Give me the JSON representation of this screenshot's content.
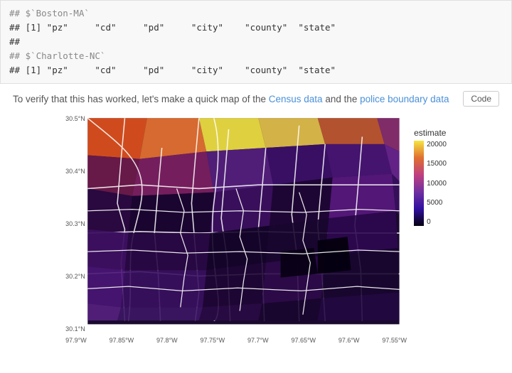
{
  "code_block": {
    "lines": [
      {
        "text": "## $`Boston-MA`",
        "type": "comment"
      },
      {
        "text": "## [1] \"pz\"     \"cd\"     \"pd\"     \"city\"    \"county\"  \"state\"",
        "type": "normal"
      },
      {
        "text": "## ",
        "type": "normal"
      },
      {
        "text": "## $`Charlotte-NC`",
        "type": "comment"
      },
      {
        "text": "## [1] \"pz\"     \"cd\"     \"pd\"     \"city\"    \"county\"  \"state\"",
        "type": "normal"
      }
    ]
  },
  "description": {
    "text": "To verify that this has worked, let's make a quick map of the Census data and the police boundary data",
    "link_words": [
      "Census data",
      "police boundary data"
    ],
    "code_button_label": "Code"
  },
  "map": {
    "y_labels": [
      "30.5°N",
      "30.4°N",
      "30.3°N",
      "30.2°N",
      "30.1°N"
    ],
    "x_labels": [
      "97.9°W",
      "97.85°W",
      "97.8°W",
      "97.75°W",
      "97.7°W",
      "97.65°W",
      "97.6°W",
      "97.55°W"
    ]
  },
  "legend": {
    "title": "estimate",
    "values": [
      "20000",
      "15000",
      "10000",
      "5000",
      "0"
    ]
  }
}
